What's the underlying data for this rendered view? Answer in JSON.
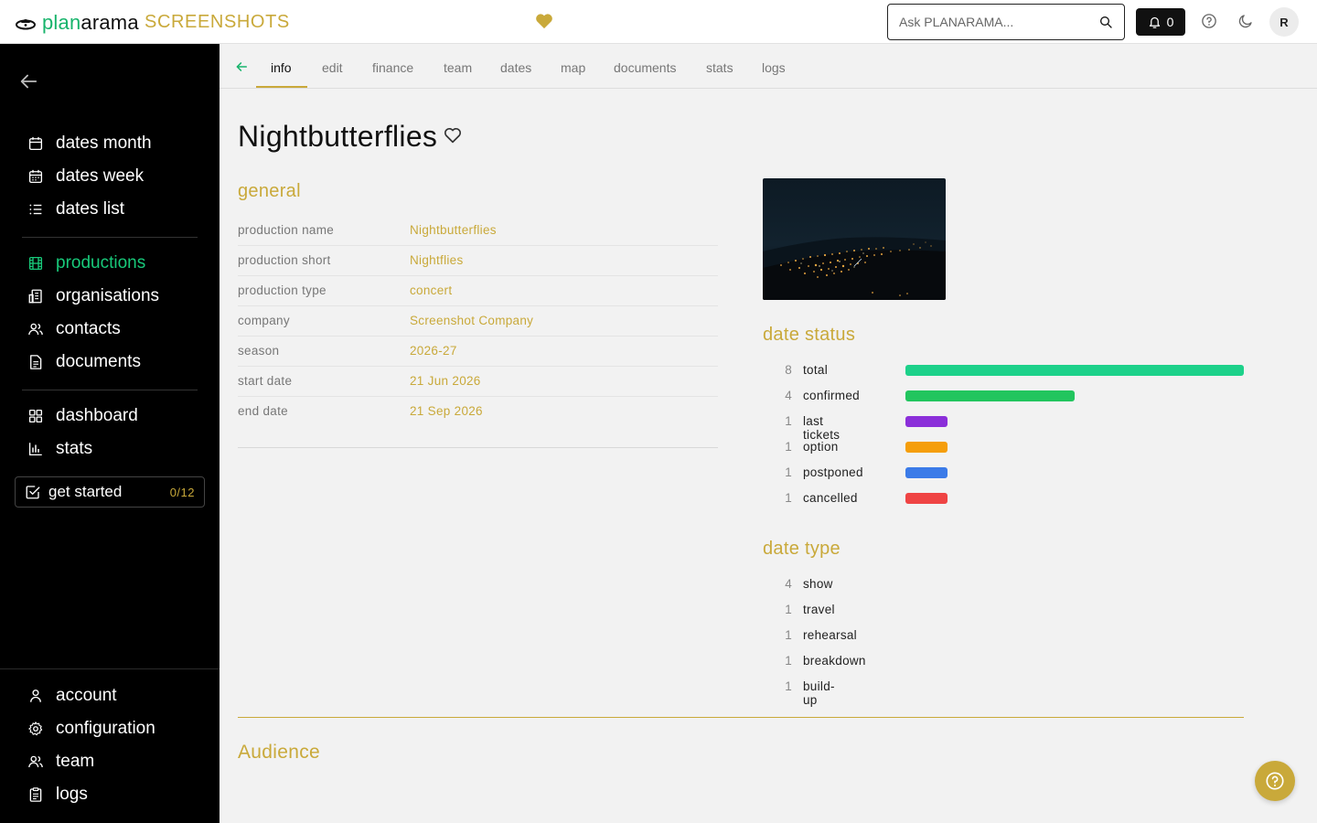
{
  "app": {
    "logo_part1": "plan",
    "logo_part2": "arama",
    "subtitle": "SCREENSHOTS"
  },
  "topbar": {
    "search_placeholder": "Ask PLANARAMA...",
    "notifications_count": "0",
    "avatar_initial": "R"
  },
  "sidebar": {
    "group1": [
      {
        "label": "dates month",
        "icon": "calendar-icon"
      },
      {
        "label": "dates week",
        "icon": "calendar-grid-icon"
      },
      {
        "label": "dates list",
        "icon": "list-icon"
      }
    ],
    "group2": [
      {
        "label": "productions",
        "icon": "film-icon",
        "active": true
      },
      {
        "label": "organisations",
        "icon": "building-icon"
      },
      {
        "label": "contacts",
        "icon": "users-icon"
      },
      {
        "label": "documents",
        "icon": "document-icon"
      }
    ],
    "group3": [
      {
        "label": "dashboard",
        "icon": "dashboard-icon"
      },
      {
        "label": "stats",
        "icon": "bar-chart-icon"
      }
    ],
    "get_started": {
      "label": "get started",
      "count": "0/12"
    },
    "bottom": [
      {
        "label": "account",
        "icon": "user-icon"
      },
      {
        "label": "configuration",
        "icon": "gear-icon"
      },
      {
        "label": "team",
        "icon": "team-icon"
      },
      {
        "label": "logs",
        "icon": "clipboard-icon"
      }
    ]
  },
  "tabs": [
    "info",
    "edit",
    "finance",
    "team",
    "dates",
    "map",
    "documents",
    "stats",
    "logs"
  ],
  "active_tab": "info",
  "production": {
    "title": "Nightbutterflies"
  },
  "general": {
    "heading": "general",
    "rows": [
      {
        "key": "production name",
        "value": "Nightbutterflies"
      },
      {
        "key": "production short",
        "value": "Nightflies"
      },
      {
        "key": "production type",
        "value": "concert"
      },
      {
        "key": "company",
        "value": "Screenshot Company"
      },
      {
        "key": "season",
        "value": "2026-27"
      },
      {
        "key": "start date",
        "value": "21 Jun 2026"
      },
      {
        "key": "end date",
        "value": "21 Sep 2026"
      }
    ]
  },
  "date_status": {
    "heading": "date status",
    "rows": [
      {
        "count": "8",
        "label": "total",
        "value": 8,
        "color": "#1dd18a"
      },
      {
        "count": "4",
        "label": "confirmed",
        "value": 4,
        "color": "#22c55e"
      },
      {
        "count": "1",
        "label": "last tickets",
        "value": 1,
        "color": "#8b2fd9"
      },
      {
        "count": "1",
        "label": "option",
        "value": 1,
        "color": "#f59e0b"
      },
      {
        "count": "1",
        "label": "postponed",
        "value": 1,
        "color": "#3b7be8"
      },
      {
        "count": "1",
        "label": "cancelled",
        "value": 1,
        "color": "#ef4444"
      }
    ]
  },
  "date_type": {
    "heading": "date type",
    "rows": [
      {
        "count": "4",
        "label": "show"
      },
      {
        "count": "1",
        "label": "travel"
      },
      {
        "count": "1",
        "label": "rehearsal"
      },
      {
        "count": "1",
        "label": "breakdown"
      },
      {
        "count": "1",
        "label": "build-up"
      }
    ]
  },
  "audience": {
    "heading": "Audience"
  },
  "colors": {
    "accent": "#c9a93a",
    "active_green": "#18c97a"
  }
}
